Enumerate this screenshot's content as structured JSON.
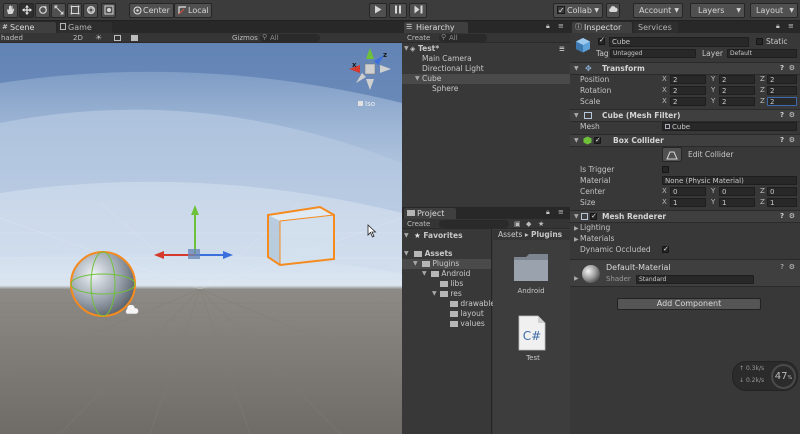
{
  "toolbar": {
    "center": "Center",
    "local": "Local",
    "collab": "Collab",
    "account": "Account",
    "layers": "Layers",
    "layout": "Layout"
  },
  "scene": {
    "tabs": [
      "Scene",
      "Game"
    ],
    "shading": "haded",
    "mode_2d": "2D",
    "gizmos": "Gizmos",
    "search_all": "All",
    "projection": "Iso",
    "gizmo_x": "x",
    "gizmo_z": "z"
  },
  "hierarchy": {
    "tab": "Hierarchy",
    "create": "Create",
    "search": "All",
    "scene_name": "Test*",
    "items": [
      "Main Camera",
      "Directional Light",
      "Cube",
      "Sphere"
    ]
  },
  "project": {
    "tab": "Project",
    "create": "Create",
    "favorites": "Favorites",
    "assets": "Assets",
    "tree": [
      "Plugins",
      "Android",
      "libs",
      "res",
      "drawable",
      "layout",
      "values"
    ],
    "breadcrumb": [
      "Assets",
      "Plugins"
    ],
    "files": [
      {
        "name": "Android",
        "icon": "folder-icon"
      },
      {
        "name": "Test",
        "icon": "csharp-script-icon"
      }
    ]
  },
  "inspector": {
    "tabs": [
      "Inspector",
      "Services"
    ],
    "object_name": "Cube",
    "static_label": "Static",
    "tag_label": "Tag",
    "tag_value": "Untagged",
    "layer_label": "Layer",
    "layer_value": "Default",
    "transform": {
      "title": "Transform",
      "rows": [
        {
          "label": "Position",
          "x": "2",
          "y": "2",
          "z": "2"
        },
        {
          "label": "Rotation",
          "x": "2",
          "y": "2",
          "z": "2"
        },
        {
          "label": "Scale",
          "x": "2",
          "y": "2",
          "z": "2"
        }
      ]
    },
    "mesh_filter": {
      "title": "Cube (Mesh Filter)",
      "mesh_label": "Mesh",
      "mesh_value": "Cube"
    },
    "box_collider": {
      "title": "Box Collider",
      "edit_label": "Edit Collider",
      "is_trigger": "Is Trigger",
      "material_label": "Material",
      "material_value": "None (Physic Material)",
      "center_label": "Center",
      "center": {
        "x": "0",
        "y": "0",
        "z": "0"
      },
      "size_label": "Size",
      "size": {
        "x": "1",
        "y": "1",
        "z": "1"
      }
    },
    "mesh_renderer": {
      "title": "Mesh Renderer",
      "lighting": "Lighting",
      "materials": "Materials",
      "dynamic_occluded": "Dynamic Occluded"
    },
    "material": {
      "name": "Default-Material",
      "shader_label": "Shader",
      "shader_value": "Standard"
    },
    "add_component": "Add Component",
    "axis_x": "X",
    "axis_y": "Y",
    "axis_z": "Z"
  },
  "stats": {
    "up": "0.3k/s",
    "down": "0.2k/s",
    "percent": "47",
    "percent_unit": "%"
  },
  "colors": {
    "accent_orange": "#f58a1f",
    "selection_blue": "#3d6aa8",
    "gizmo_red": "#d63a2c",
    "gizmo_green": "#6fc13a",
    "gizmo_blue": "#3b6fdc"
  }
}
